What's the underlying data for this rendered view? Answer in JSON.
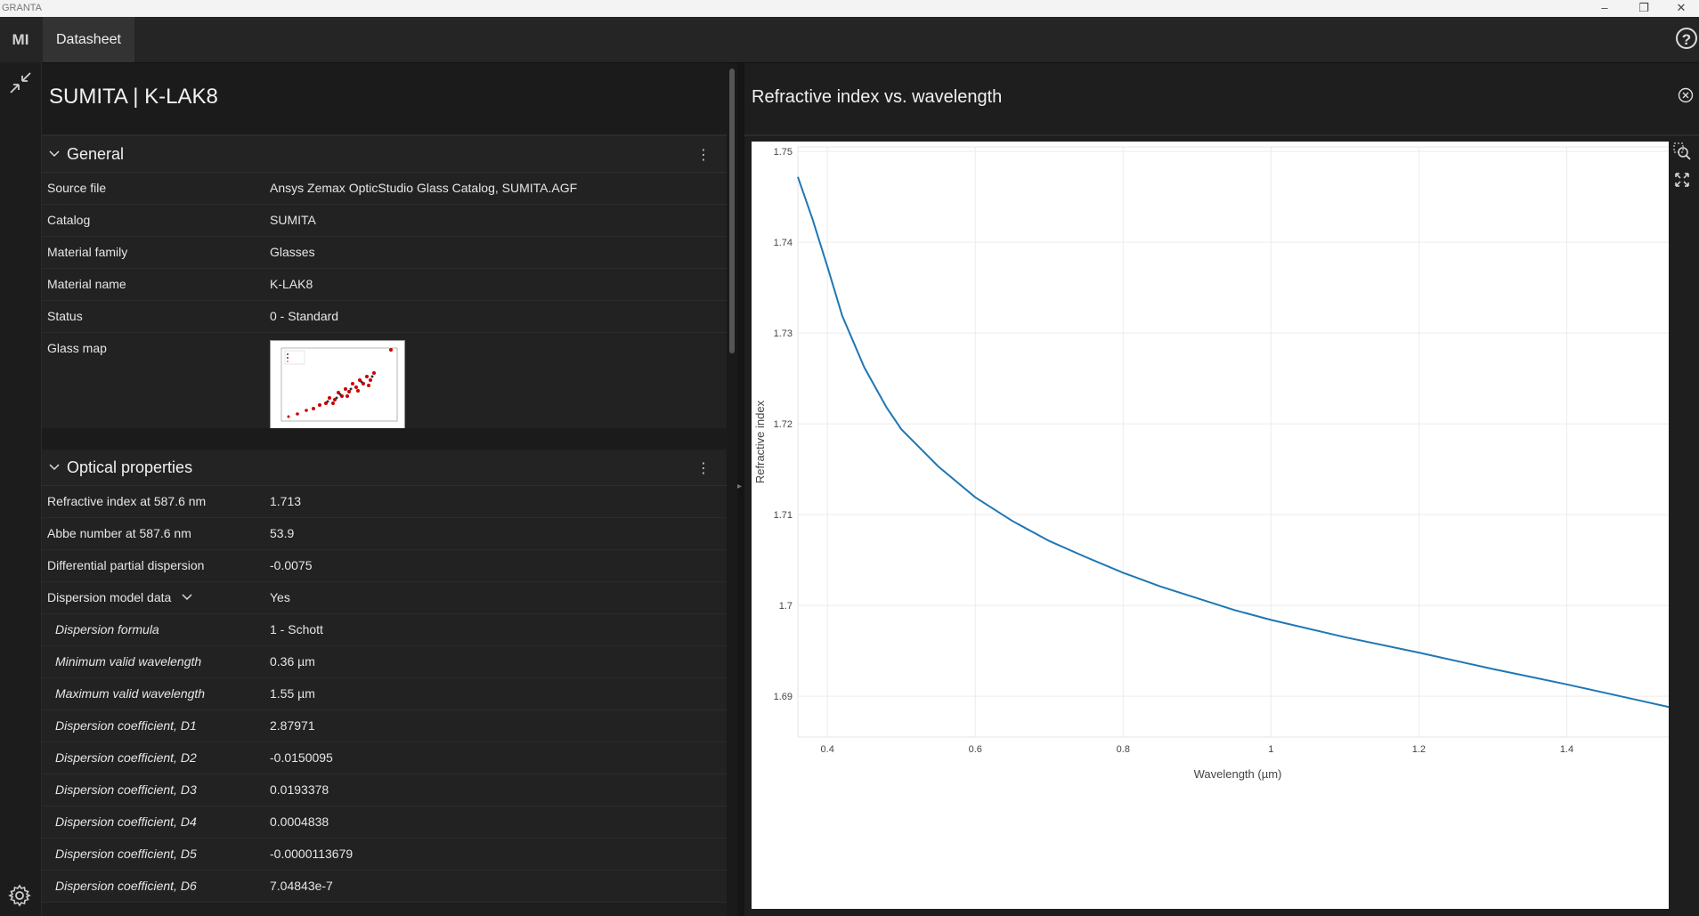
{
  "app": {
    "window_title": "GRANTA",
    "logo": "MI",
    "tab": "Datasheet",
    "help_glyph": "?"
  },
  "material": {
    "title": "SUMITA | K-LAK8"
  },
  "sections": {
    "general": {
      "label": "General",
      "rows": [
        {
          "key": "Source file",
          "value": "Ansys Zemax OpticStudio Glass Catalog, SUMITA.AGF"
        },
        {
          "key": "Catalog",
          "value": "SUMITA"
        },
        {
          "key": "Material family",
          "value": "Glasses"
        },
        {
          "key": "Material name",
          "value": "K-LAK8"
        },
        {
          "key": "Status",
          "value": "0 - Standard"
        },
        {
          "key": "Glass map",
          "value": ""
        }
      ]
    },
    "optical": {
      "label": "Optical properties",
      "rows": [
        {
          "key": "Refractive index at 587.6 nm",
          "value": "1.713"
        },
        {
          "key": "Abbe number at 587.6 nm",
          "value": "53.9"
        },
        {
          "key": "Differential partial dispersion",
          "value": "-0.0075"
        },
        {
          "key": "Dispersion model data",
          "value": "Yes"
        },
        {
          "key": "Dispersion formula",
          "value": "1 - Schott"
        },
        {
          "key": "Minimum valid wavelength",
          "value": "0.36 µm"
        },
        {
          "key": "Maximum valid wavelength",
          "value": "1.55 µm"
        },
        {
          "key": "Dispersion coefficient, D1",
          "value": "2.87971"
        },
        {
          "key": "Dispersion coefficient, D2",
          "value": "-0.0150095"
        },
        {
          "key": "Dispersion coefficient, D3",
          "value": "0.0193378"
        },
        {
          "key": "Dispersion coefficient, D4",
          "value": "0.0004838"
        },
        {
          "key": "Dispersion coefficient, D5",
          "value": "-0.0000113679"
        },
        {
          "key": "Dispersion coefficient, D6",
          "value": "7.04843e-7"
        }
      ]
    }
  },
  "chart_panel": {
    "title": "Refractive index vs. wavelength",
    "tools": [
      "zoom-icon",
      "fit-icon"
    ]
  },
  "chart_data": {
    "type": "line",
    "title": "Refractive index vs. wavelength",
    "xlabel": "Wavelength (µm)",
    "ylabel": "Refractive index",
    "xlim": [
      0.36,
      1.55
    ],
    "ylim": [
      1.6855,
      1.7505
    ],
    "xticks": [
      0.4,
      0.6,
      0.8,
      1,
      1.2,
      1.4
    ],
    "xtick_labels": [
      "0.4",
      "0.6",
      "0.8",
      "1",
      "1.2",
      "1.4"
    ],
    "yticks": [
      1.69,
      1.7,
      1.71,
      1.72,
      1.73,
      1.74,
      1.75
    ],
    "ytick_labels": [
      "1.69",
      "1.7",
      "1.71",
      "1.72",
      "1.73",
      "1.74",
      "1.75"
    ],
    "grid": true,
    "color": "#1f77b4",
    "series": [
      {
        "x": [
          0.36,
          0.38,
          0.4,
          0.42,
          0.45,
          0.48,
          0.5,
          0.55,
          0.6,
          0.65,
          0.7,
          0.75,
          0.8,
          0.85,
          0.9,
          0.95,
          1.0,
          1.1,
          1.2,
          1.3,
          1.4,
          1.5,
          1.55
        ],
        "y": [
          1.7472,
          1.7425,
          1.7373,
          1.7319,
          1.7262,
          1.7218,
          1.7194,
          1.7153,
          1.7119,
          1.7093,
          1.7071,
          1.7053,
          1.7036,
          1.7021,
          1.7008,
          1.6995,
          1.6984,
          1.6965,
          1.6948,
          1.693,
          1.6913,
          1.6895,
          1.6886
        ]
      }
    ]
  }
}
